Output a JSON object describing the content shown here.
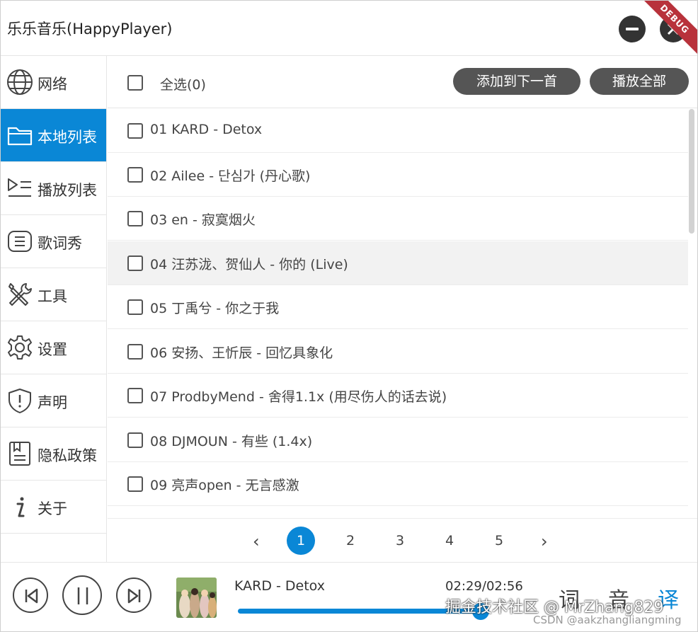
{
  "window": {
    "title": "乐乐音乐(HappyPlayer)",
    "debug_label": "DEBUG"
  },
  "sidebar": {
    "items": [
      {
        "label": "网络",
        "icon": "globe-icon"
      },
      {
        "label": "本地列表",
        "icon": "folder-icon"
      },
      {
        "label": "播放列表",
        "icon": "playlist-icon"
      },
      {
        "label": "歌词秀",
        "icon": "lyrics-icon"
      },
      {
        "label": "工具",
        "icon": "tools-icon"
      },
      {
        "label": "设置",
        "icon": "gear-icon"
      },
      {
        "label": "声明",
        "icon": "shield-icon"
      },
      {
        "label": "隐私政策",
        "icon": "document-icon"
      },
      {
        "label": "关于",
        "icon": "info-icon"
      }
    ],
    "active_index": 1
  },
  "toolbar": {
    "select_all_label": "全选(0)",
    "add_next_label": "添加到下一首",
    "play_all_label": "播放全部"
  },
  "songs": [
    "01 KARD - Detox",
    "02 Ailee - 단심가 (丹心歌)",
    "03 en - 寂寞烟火",
    "04 汪苏泷、贺仙人 - 你的 (Live)",
    "05 丁禹兮 - 你之于我",
    "06 安扬、王忻辰 - 回忆具象化",
    "07 ProdbyMend - 舍得1.1x (用尽伤人的话去说)",
    "08 DJMOUN - 有些 (1.4x)",
    "09 亮声open - 无言感激"
  ],
  "pager": {
    "prev": "‹",
    "next": "›",
    "pages": [
      "1",
      "2",
      "3",
      "4",
      "5"
    ],
    "current": "1"
  },
  "player": {
    "now_playing": "KARD - Detox",
    "time": "02:29/02:56",
    "progress": 0.85,
    "modes": [
      "词",
      "音",
      "译"
    ],
    "active_mode": "译"
  },
  "watermark": {
    "line1": "掘金技术社区 @ MrZhang829",
    "line2": "CSDN @aakzhangliangming"
  },
  "colors": {
    "accent": "#0a87d6",
    "pill": "#555555",
    "debug": "#b8323b"
  }
}
